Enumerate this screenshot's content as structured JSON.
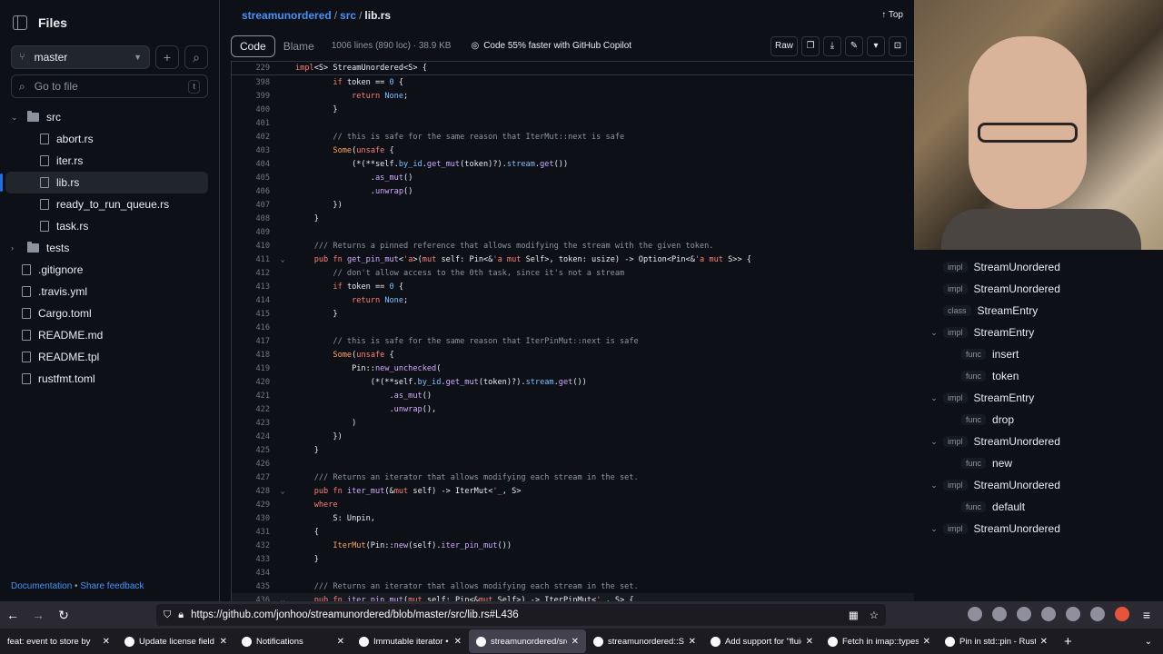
{
  "sidebar": {
    "title": "Files",
    "branch": "master",
    "goto_placeholder": "Go to file",
    "goto_key": "t",
    "tree": [
      {
        "label": "src",
        "type": "folder",
        "expanded": true,
        "depth": 0
      },
      {
        "label": "abort.rs",
        "type": "file",
        "depth": 1
      },
      {
        "label": "iter.rs",
        "type": "file",
        "depth": 1
      },
      {
        "label": "lib.rs",
        "type": "file",
        "depth": 1,
        "selected": true
      },
      {
        "label": "ready_to_run_queue.rs",
        "type": "file",
        "depth": 1
      },
      {
        "label": "task.rs",
        "type": "file",
        "depth": 1
      },
      {
        "label": "tests",
        "type": "folder",
        "expanded": false,
        "depth": 0
      },
      {
        "label": ".gitignore",
        "type": "file",
        "depth": 0
      },
      {
        "label": ".travis.yml",
        "type": "file",
        "depth": 0
      },
      {
        "label": "Cargo.toml",
        "type": "file",
        "depth": 0
      },
      {
        "label": "README.md",
        "type": "file",
        "depth": 0
      },
      {
        "label": "README.tpl",
        "type": "file",
        "depth": 0
      },
      {
        "label": "rustfmt.toml",
        "type": "file",
        "depth": 0
      }
    ],
    "footer_docs": "Documentation",
    "footer_sep": "•",
    "footer_feedback": "Share feedback"
  },
  "breadcrumb": {
    "repo": "streamunordered",
    "dir": "src",
    "file": "lib.rs",
    "sep": "/"
  },
  "top_label": "↑ Top",
  "toolbar": {
    "code_tab": "Code",
    "blame_tab": "Blame",
    "meta": "1006 lines (890 loc) · 38.9 KB",
    "copilot": "Code 55% faster with GitHub Copilot",
    "raw": "Raw"
  },
  "sticky": {
    "num": "229",
    "text": "impl<S> StreamUnordered<S> {"
  },
  "code_lines": [
    {
      "num": "398",
      "html": "        <span class='k'>if</span> token == <span class='n'>0</span> {"
    },
    {
      "num": "399",
      "html": "            <span class='k'>return</span> <span class='m'>None</span>;"
    },
    {
      "num": "400",
      "html": "        }"
    },
    {
      "num": "401",
      "html": ""
    },
    {
      "num": "402",
      "html": "        <span class='c'>// this is safe for the same reason that IterMut::next is safe</span>"
    },
    {
      "num": "403",
      "html": "        <span class='t'>Some</span>(<span class='k'>unsafe</span> {"
    },
    {
      "num": "404",
      "html": "            (*(**self.<span class='m'>by_id</span>.<span class='f'>get_mut</span>(token)?).<span class='m'>stream</span>.<span class='f'>get</span>())"
    },
    {
      "num": "405",
      "html": "                .<span class='f'>as_mut</span>()"
    },
    {
      "num": "406",
      "html": "                .<span class='f'>unwrap</span>()"
    },
    {
      "num": "407",
      "html": "        })"
    },
    {
      "num": "408",
      "html": "    }"
    },
    {
      "num": "409",
      "html": ""
    },
    {
      "num": "410",
      "html": "    <span class='c'>/// Returns a pinned reference that allows modifying the stream with the given token.</span>"
    },
    {
      "num": "411",
      "fold": true,
      "html": "    <span class='k'>pub fn</span> <span class='f'>get_pin_mut</span>&lt;<span class='k'>'a</span>&gt;(<span class='k'>mut</span> self: Pin&lt;&amp;<span class='k'>'a mut</span> Self&gt;, token: usize) -&gt; Option&lt;Pin&lt;&amp;<span class='k'>'a mut</span> S&gt;&gt; {"
    },
    {
      "num": "412",
      "html": "        <span class='c'>// don't allow access to the 0th task, since it's not a stream</span>"
    },
    {
      "num": "413",
      "html": "        <span class='k'>if</span> token == <span class='n'>0</span> {"
    },
    {
      "num": "414",
      "html": "            <span class='k'>return</span> <span class='m'>None</span>;"
    },
    {
      "num": "415",
      "html": "        }"
    },
    {
      "num": "416",
      "html": ""
    },
    {
      "num": "417",
      "html": "        <span class='c'>// this is safe for the same reason that IterPinMut::next is safe</span>"
    },
    {
      "num": "418",
      "html": "        <span class='t'>Some</span>(<span class='k'>unsafe</span> {"
    },
    {
      "num": "419",
      "html": "            Pin::<span class='f'>new_unchecked</span>("
    },
    {
      "num": "420",
      "html": "                (*(**self.<span class='m'>by_id</span>.<span class='f'>get_mut</span>(token)?).<span class='m'>stream</span>.<span class='f'>get</span>())"
    },
    {
      "num": "421",
      "html": "                    .<span class='f'>as_mut</span>()"
    },
    {
      "num": "422",
      "html": "                    .<span class='f'>unwrap</span>(),"
    },
    {
      "num": "423",
      "html": "            )"
    },
    {
      "num": "424",
      "html": "        })"
    },
    {
      "num": "425",
      "html": "    }"
    },
    {
      "num": "426",
      "html": ""
    },
    {
      "num": "427",
      "html": "    <span class='c'>/// Returns an iterator that allows modifying each stream in the set.</span>"
    },
    {
      "num": "428",
      "fold": true,
      "html": "    <span class='k'>pub fn</span> <span class='f'>iter_mut</span>(&amp;<span class='k'>mut</span> self) -&gt; IterMut&lt;<span class='k'>'_</span>, S&gt;"
    },
    {
      "num": "429",
      "html": "    <span class='k'>where</span>"
    },
    {
      "num": "430",
      "html": "        S: Unpin,"
    },
    {
      "num": "431",
      "html": "    {"
    },
    {
      "num": "432",
      "html": "        <span class='t'>IterMut</span>(Pin::<span class='f'>new</span>(self).<span class='f'>iter_pin_mut</span>())"
    },
    {
      "num": "433",
      "html": "    }"
    },
    {
      "num": "434",
      "html": ""
    },
    {
      "num": "435",
      "html": "    <span class='c'>/// Returns an iterator that allows modifying each stream in the set.</span>"
    },
    {
      "num": "436",
      "fold": true,
      "hl": true,
      "html": "    <span class='k'>pub fn</span> <span class='f'>iter_pin_mut</span>(<span class='k'>mut</span> self: Pin&lt;&amp;<span class='k'>mut</span> Self&gt;) -&gt; IterPinMut&lt;<span class='k'>'_</span>, S&gt; {"
    }
  ],
  "outline": [
    {
      "kind": "impl",
      "name": "StreamUnordered",
      "chev": false,
      "indent": 0
    },
    {
      "kind": "impl",
      "name": "StreamUnordered",
      "chev": false,
      "indent": 0
    },
    {
      "kind": "class",
      "name": "StreamEntry",
      "chev": false,
      "indent": 0
    },
    {
      "kind": "impl",
      "name": "StreamEntry",
      "chev": true,
      "indent": 0
    },
    {
      "kind": "func",
      "name": "insert",
      "chev": false,
      "indent": 1
    },
    {
      "kind": "func",
      "name": "token",
      "chev": false,
      "indent": 1
    },
    {
      "kind": "impl",
      "name": "StreamEntry",
      "chev": true,
      "indent": 0
    },
    {
      "kind": "func",
      "name": "drop",
      "chev": false,
      "indent": 1
    },
    {
      "kind": "impl",
      "name": "StreamUnordered",
      "chev": true,
      "indent": 0
    },
    {
      "kind": "func",
      "name": "new",
      "chev": false,
      "indent": 1
    },
    {
      "kind": "impl",
      "name": "StreamUnordered",
      "chev": true,
      "indent": 0
    },
    {
      "kind": "func",
      "name": "default",
      "chev": false,
      "indent": 1
    },
    {
      "kind": "impl",
      "name": "StreamUnordered",
      "chev": true,
      "indent": 0
    }
  ],
  "browser": {
    "url": "https://github.com/jonhoo/streamunordered/blob/master/src/lib.rs#L436",
    "tabs": [
      {
        "title": "feat: event to store by",
        "icon": false
      },
      {
        "title": "Update license field fo",
        "icon": true
      },
      {
        "title": "Notifications",
        "icon": true
      },
      {
        "title": "Immutable iterator •",
        "icon": true
      },
      {
        "title": "streamunordered/src/",
        "icon": true,
        "active": true
      },
      {
        "title": "streamunordered::Str",
        "icon": true
      },
      {
        "title": "Add support for \"fluid",
        "icon": true
      },
      {
        "title": "Fetch in imap::types",
        "icon": true
      },
      {
        "title": "Pin in std::pin - Rust",
        "icon": true
      }
    ]
  }
}
